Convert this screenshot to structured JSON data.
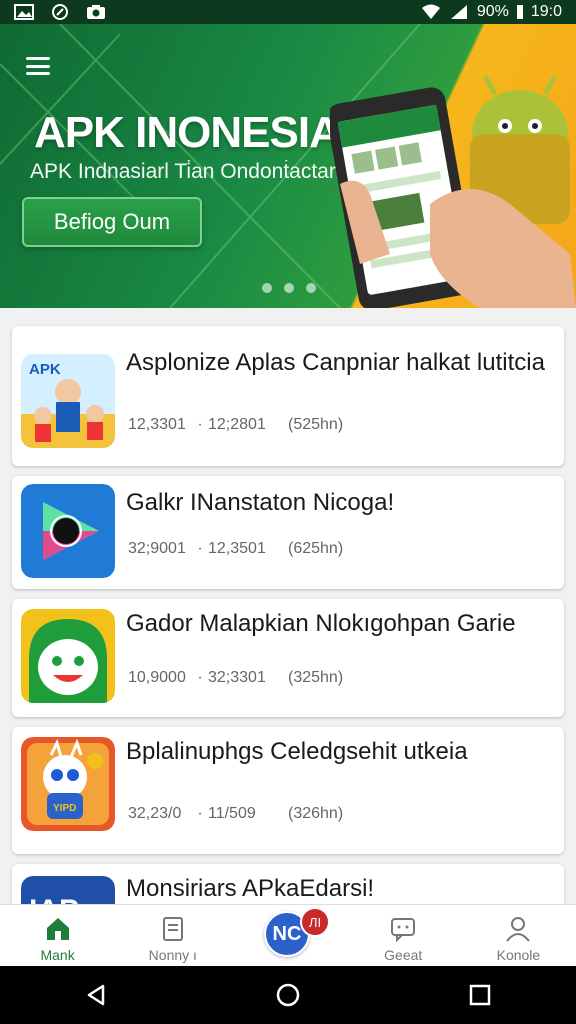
{
  "status_bar": {
    "battery": "90%",
    "time": "19:0",
    "icons": [
      "image-icon",
      "shield-icon",
      "camera-icon",
      "wifi-icon",
      "signal-icon"
    ]
  },
  "hero": {
    "title": "APK INONESIA",
    "subtitle": "APK Indnasiarl Ti̇an Ondonṫactaria",
    "button_label": "Befiog Oum",
    "dots": 3,
    "colors": {
      "green": "#1a8a45",
      "yellow": "#f5b71b"
    }
  },
  "apps": [
    {
      "title": "Asplonize Aplas Canpniar halkat lutitcia",
      "meta1": "12,3301",
      "meta2": "12;2801",
      "size": "(525hn)",
      "icon": "apk-kids-icon"
    },
    {
      "title": "Galkr INanstaton Nicoga!",
      "meta1": "32;9001",
      "meta2": "12,3501",
      "size": "(625hn)",
      "icon": "play-triangle-icon"
    },
    {
      "title": "Gador Malapkian Nlokıgohpan Garie",
      "meta1": "10,9000",
      "meta2": "32;3301",
      "size": "(325hn)",
      "icon": "green-face-icon"
    },
    {
      "title": "Bplalinuphgs Celedgsehit utkeia",
      "meta1": "32,23/0",
      "meta2": "11/509",
      "size": "(326hn)",
      "icon": "mascot-icon"
    },
    {
      "title": "Monsiriars APkaEdarsi!",
      "icon": "iap-logo-icon"
    }
  ],
  "bottom_nav": {
    "items": [
      {
        "label": "Mank",
        "icon": "home-icon"
      },
      {
        "label": "Nonny ı",
        "icon": "document-icon"
      },
      {
        "label": "NC",
        "badge": "ЛІ",
        "icon": "nc-logo-icon"
      },
      {
        "label": "Geeat",
        "icon": "chat-icon"
      },
      {
        "label": "Konole",
        "icon": "profile-icon"
      }
    ]
  },
  "system_nav": [
    "back-icon",
    "home-circle-icon",
    "recents-icon"
  ]
}
